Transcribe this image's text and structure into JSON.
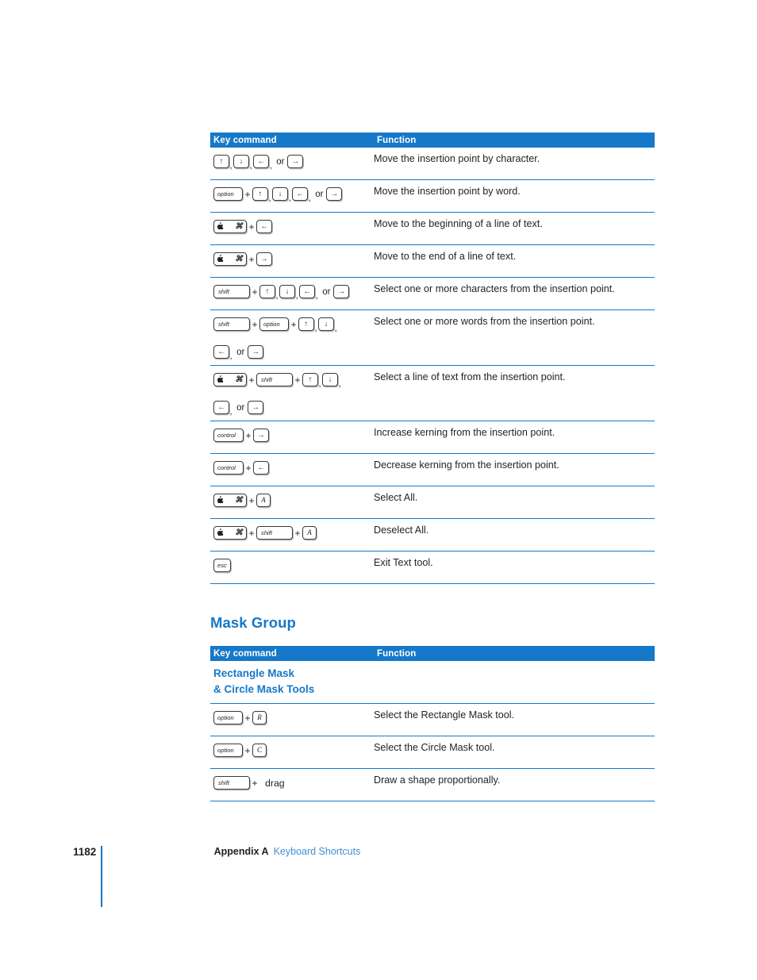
{
  "document": {
    "page_number": "1182",
    "footer_appendix": "Appendix A",
    "footer_title": "Keyboard Shortcuts"
  },
  "colors": {
    "accent_blue": "#1678c8",
    "link_blue": "#3f8fd1",
    "text": "#231f20"
  },
  "tables": [
    {
      "id": "text-tool-shortcuts",
      "headers": {
        "key_command": "Key command",
        "function": "Function"
      },
      "rows": [
        {
          "keys": [
            {
              "type": "arrow",
              "glyph": "↑",
              "name": "arrow-up-key"
            },
            {
              "type": "comma"
            },
            {
              "type": "arrow",
              "glyph": "↓",
              "name": "arrow-down-key"
            },
            {
              "type": "comma"
            },
            {
              "type": "arrow",
              "glyph": "←",
              "name": "arrow-left-key"
            },
            {
              "type": "comma"
            },
            {
              "type": "or",
              "text": "or"
            },
            {
              "type": "arrow",
              "glyph": "→",
              "name": "arrow-right-key"
            }
          ],
          "function": "Move the insertion point by character."
        },
        {
          "keys": [
            {
              "type": "mod",
              "label": "option",
              "width": "opt",
              "name": "option-key"
            },
            {
              "type": "plus"
            },
            {
              "type": "arrow",
              "glyph": "↑",
              "name": "arrow-up-key"
            },
            {
              "type": "comma"
            },
            {
              "type": "arrow",
              "glyph": "↓",
              "name": "arrow-down-key"
            },
            {
              "type": "comma"
            },
            {
              "type": "arrow",
              "glyph": "←",
              "name": "arrow-left-key"
            },
            {
              "type": "comma"
            },
            {
              "type": "or",
              "text": "or"
            },
            {
              "type": "arrow",
              "glyph": "→",
              "name": "arrow-right-key"
            }
          ],
          "function": "Move the insertion point by word."
        },
        {
          "keys": [
            {
              "type": "command",
              "apple": "",
              "symbol": "⌘",
              "name": "command-key"
            },
            {
              "type": "plus"
            },
            {
              "type": "arrow",
              "glyph": "←",
              "name": "arrow-left-key"
            }
          ],
          "function": "Move to the beginning of a line of text."
        },
        {
          "keys": [
            {
              "type": "command",
              "apple": "",
              "symbol": "⌘",
              "name": "command-key"
            },
            {
              "type": "plus"
            },
            {
              "type": "arrow",
              "glyph": "→",
              "name": "arrow-right-key"
            }
          ],
          "function": "Move to the end of a line of text."
        },
        {
          "keys": [
            {
              "type": "mod",
              "label": "shift",
              "width": "wide",
              "name": "shift-key"
            },
            {
              "type": "plus"
            },
            {
              "type": "arrow",
              "glyph": "↑",
              "name": "arrow-up-key"
            },
            {
              "type": "comma"
            },
            {
              "type": "arrow",
              "glyph": "↓",
              "name": "arrow-down-key"
            },
            {
              "type": "comma"
            },
            {
              "type": "arrow",
              "glyph": "←",
              "name": "arrow-left-key"
            },
            {
              "type": "comma"
            },
            {
              "type": "or",
              "text": "or"
            },
            {
              "type": "arrow",
              "glyph": "→",
              "name": "arrow-right-key"
            }
          ],
          "function": "Select one or more characters from the insertion point."
        },
        {
          "keys": [
            {
              "type": "mod",
              "label": "shift",
              "width": "wide",
              "name": "shift-key"
            },
            {
              "type": "plus"
            },
            {
              "type": "mod",
              "label": "option",
              "width": "opt",
              "name": "option-key"
            },
            {
              "type": "plus"
            },
            {
              "type": "arrow",
              "glyph": "↑",
              "name": "arrow-up-key"
            },
            {
              "type": "comma"
            },
            {
              "type": "arrow",
              "glyph": "↓",
              "name": "arrow-down-key"
            },
            {
              "type": "comma"
            },
            {
              "type": "break"
            },
            {
              "type": "arrow",
              "glyph": "←",
              "name": "arrow-left-key"
            },
            {
              "type": "comma"
            },
            {
              "type": "or",
              "text": "or"
            },
            {
              "type": "arrow",
              "glyph": "→",
              "name": "arrow-right-key"
            }
          ],
          "function": "Select one or more words from the insertion point."
        },
        {
          "keys": [
            {
              "type": "command",
              "apple": "",
              "symbol": "⌘",
              "name": "command-key"
            },
            {
              "type": "plus"
            },
            {
              "type": "mod",
              "label": "shift",
              "width": "wide",
              "name": "shift-key"
            },
            {
              "type": "plus"
            },
            {
              "type": "arrow",
              "glyph": "↑",
              "name": "arrow-up-key"
            },
            {
              "type": "comma"
            },
            {
              "type": "arrow",
              "glyph": "↓",
              "name": "arrow-down-key"
            },
            {
              "type": "comma"
            },
            {
              "type": "break"
            },
            {
              "type": "arrow",
              "glyph": "←",
              "name": "arrow-left-key"
            },
            {
              "type": "comma"
            },
            {
              "type": "or",
              "text": "or"
            },
            {
              "type": "arrow",
              "glyph": "→",
              "name": "arrow-right-key"
            }
          ],
          "function": "Select a line of text from the insertion point."
        },
        {
          "keys": [
            {
              "type": "mod",
              "label": "control",
              "width": "ctrl",
              "name": "control-key"
            },
            {
              "type": "plus"
            },
            {
              "type": "arrow",
              "glyph": "→",
              "name": "arrow-right-key"
            }
          ],
          "function": "Increase kerning from the insertion point."
        },
        {
          "keys": [
            {
              "type": "mod",
              "label": "control",
              "width": "ctrl",
              "name": "control-key"
            },
            {
              "type": "plus"
            },
            {
              "type": "arrow",
              "glyph": "←",
              "name": "arrow-left-key"
            }
          ],
          "function": "Decrease kerning from the insertion point."
        },
        {
          "keys": [
            {
              "type": "command",
              "apple": "",
              "symbol": "⌘",
              "name": "command-key"
            },
            {
              "type": "plus"
            },
            {
              "type": "letter",
              "label": "A",
              "name": "a-key"
            }
          ],
          "function": "Select All."
        },
        {
          "keys": [
            {
              "type": "command",
              "apple": "",
              "symbol": "⌘",
              "name": "command-key"
            },
            {
              "type": "plus"
            },
            {
              "type": "mod",
              "label": "shift",
              "width": "wide",
              "name": "shift-key"
            },
            {
              "type": "plus"
            },
            {
              "type": "letter",
              "label": "A",
              "name": "a-key"
            }
          ],
          "function": "Deselect All."
        },
        {
          "keys": [
            {
              "type": "mod",
              "label": "esc",
              "width": "esc",
              "name": "escape-key"
            }
          ],
          "function": "Exit Text tool."
        }
      ]
    },
    {
      "id": "mask-group-shortcuts",
      "headers": {
        "key_command": "Key command",
        "function": "Function"
      },
      "subheading_line1": "Rectangle Mask",
      "subheading_line2": "& Circle Mask Tools",
      "rows": [
        {
          "keys": [
            {
              "type": "mod",
              "label": "option",
              "width": "opt",
              "name": "option-key"
            },
            {
              "type": "plus"
            },
            {
              "type": "letter",
              "label": "R",
              "name": "r-key"
            }
          ],
          "function": "Select the Rectangle Mask tool."
        },
        {
          "keys": [
            {
              "type": "mod",
              "label": "option",
              "width": "opt",
              "name": "option-key"
            },
            {
              "type": "plus"
            },
            {
              "type": "letter",
              "label": "C",
              "name": "c-key"
            }
          ],
          "function": "Select the Circle Mask tool."
        },
        {
          "keys": [
            {
              "type": "mod",
              "label": "shift",
              "width": "wide",
              "name": "shift-key"
            },
            {
              "type": "plus"
            },
            {
              "type": "text",
              "text": "drag"
            }
          ],
          "function": "Draw a shape proportionally."
        }
      ]
    }
  ],
  "sections": {
    "mask_group_heading": "Mask Group"
  }
}
